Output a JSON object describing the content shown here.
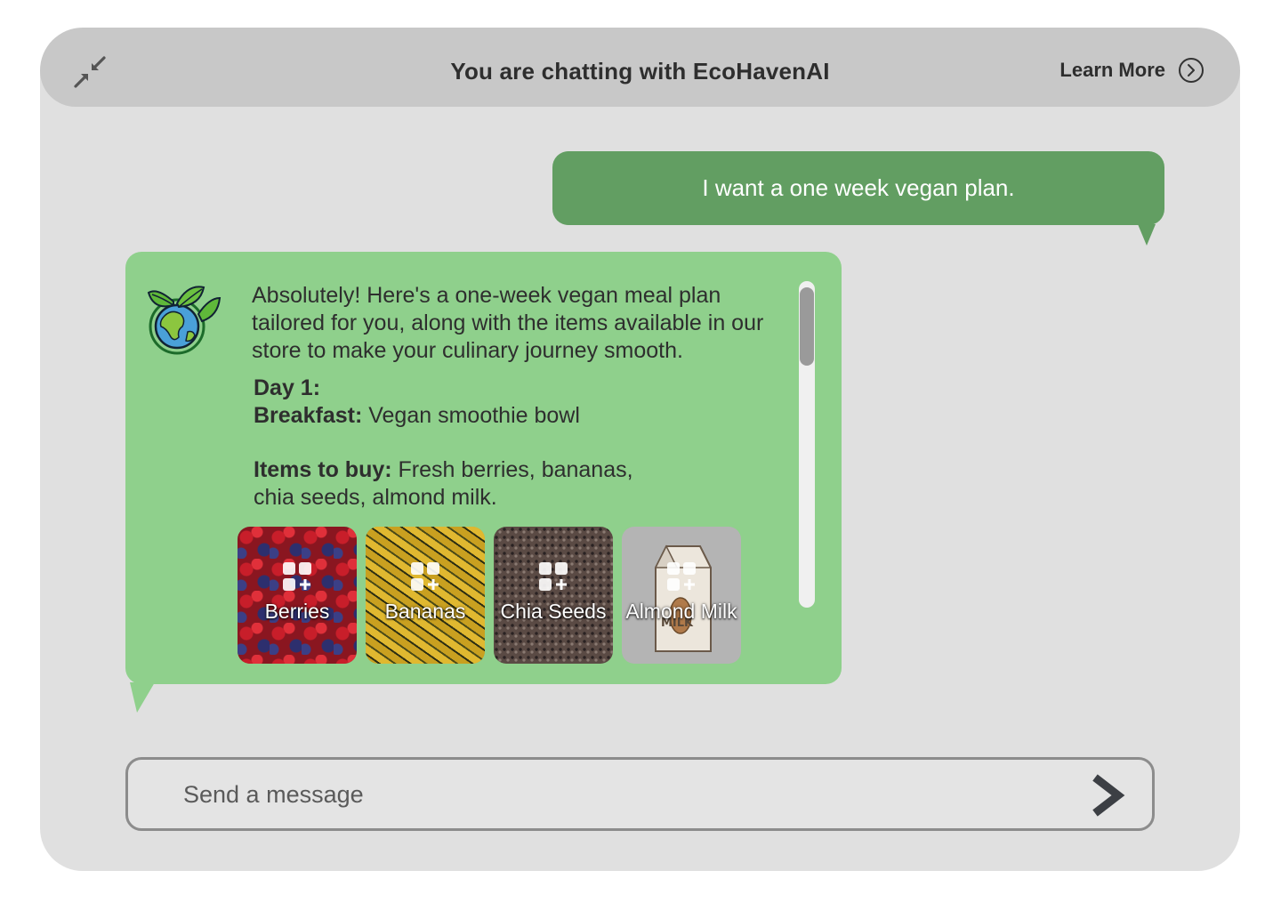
{
  "header": {
    "title": "You are chatting with EcoHavenAI",
    "learn_more": "Learn More"
  },
  "messages": {
    "user": "I want a one week vegan plan.",
    "bot": {
      "intro": "Absolutely! Here's a one-week vegan meal plan tailored for you, along with the items available in our store to make your culinary journey smooth.",
      "day_label": "Day 1:",
      "breakfast_label": "Breakfast:",
      "breakfast_value": "Vegan smoothie bowl",
      "items_label": "Items to buy:",
      "items_value": "Fresh berries, bananas, chia seeds, almond milk."
    }
  },
  "products": [
    {
      "label": "Berries",
      "icon": "add-to-cart-icon"
    },
    {
      "label": "Bananas",
      "icon": "add-to-cart-icon"
    },
    {
      "label": "Chia Seeds",
      "icon": "add-to-cart-icon"
    },
    {
      "label": "Almond Milk",
      "icon": "add-to-cart-icon",
      "carton_text": "MILK"
    }
  ],
  "composer": {
    "placeholder": "Send a message"
  },
  "colors": {
    "user_bubble": "#629e62",
    "bot_bubble": "#8fd08c",
    "header": "#c8c8c8",
    "window": "#e0e0e0"
  }
}
